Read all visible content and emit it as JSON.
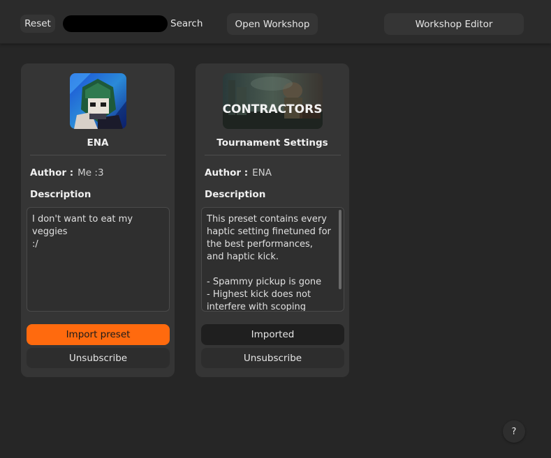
{
  "toolbar": {
    "reset_label": "Reset",
    "search_value": "",
    "search_label": "Search",
    "open_workshop_label": "Open Workshop",
    "workshop_editor_label": "Workshop Editor"
  },
  "cards": [
    {
      "title": "ENA",
      "author_label": "Author :",
      "author": "Me :3",
      "description_label": "Description",
      "description": "I don't want to eat my veggies\n:/",
      "action_label": "Import preset",
      "action_state": "import",
      "unsubscribe_label": "Unsubscribe"
    },
    {
      "title": "Tournament Settings",
      "thumb_text": "CONTRACTORS",
      "author_label": "Author :",
      "author": "ENA",
      "description_label": "Description",
      "description": "This preset contains every haptic setting finetuned for the best performances, and haptic kick.\n\n- Spammy pickup is gone\n- Highest kick does not interfere with scoping",
      "action_label": "Imported",
      "action_state": "imported",
      "unsubscribe_label": "Unsubscribe"
    }
  ],
  "help_label": "?",
  "colors": {
    "accent": "#ff6a0e",
    "background": "#262626",
    "card": "#353535"
  }
}
